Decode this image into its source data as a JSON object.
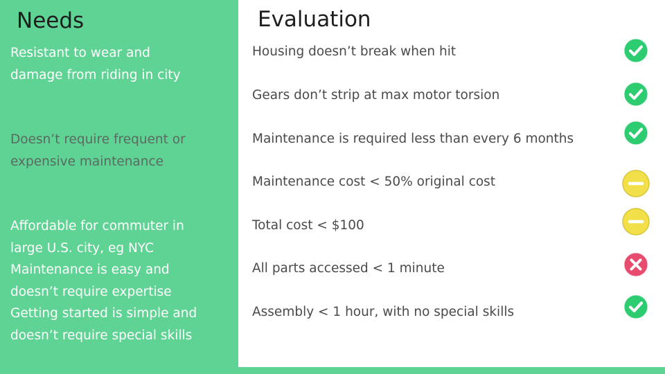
{
  "needs": {
    "title": "Needs",
    "items": [
      {
        "lines": [
          "Resistant to wear and",
          "damage from riding in city"
        ],
        "tone": "light"
      },
      {
        "lines": [
          "Doesn’t require frequent or",
          "expensive maintenance"
        ],
        "tone": "muted"
      },
      {
        "lines": [
          "Affordable for commuter in",
          "large U.S. city, eg NYC",
          "Maintenance is easy and",
          "doesn’t require expertise",
          "Getting started is simple and",
          "doesn’t require special skills"
        ],
        "tone": "light"
      }
    ]
  },
  "evaluation": {
    "title": "Evaluation",
    "rows": [
      {
        "text": "Housing doesn’t break when hit",
        "status": "pass",
        "icon": "check-circle-icon"
      },
      {
        "text": "Gears don’t strip at max motor torsion",
        "status": "pass",
        "icon": "check-circle-icon"
      },
      {
        "text": "Maintenance is required less than every 6 months",
        "status": "pass",
        "icon": "check-circle-icon"
      },
      {
        "text": "Maintenance cost   <  50% original cost",
        "status": "partial",
        "icon": "minus-circle-icon"
      },
      {
        "text": "Total cost < $100",
        "status": "partial",
        "icon": "minus-circle-icon"
      },
      {
        "text": "All parts accessed < 1 minute",
        "status": "fail",
        "icon": "x-circle-icon"
      },
      {
        "text": "Assembly <  1 hour, with no special skills",
        "status": "pass",
        "icon": "check-circle-icon"
      }
    ]
  },
  "colors": {
    "panel": "#5fd394",
    "pass": "#2ecc71",
    "partial": "#f1e04a",
    "fail": "#e74c6f"
  }
}
